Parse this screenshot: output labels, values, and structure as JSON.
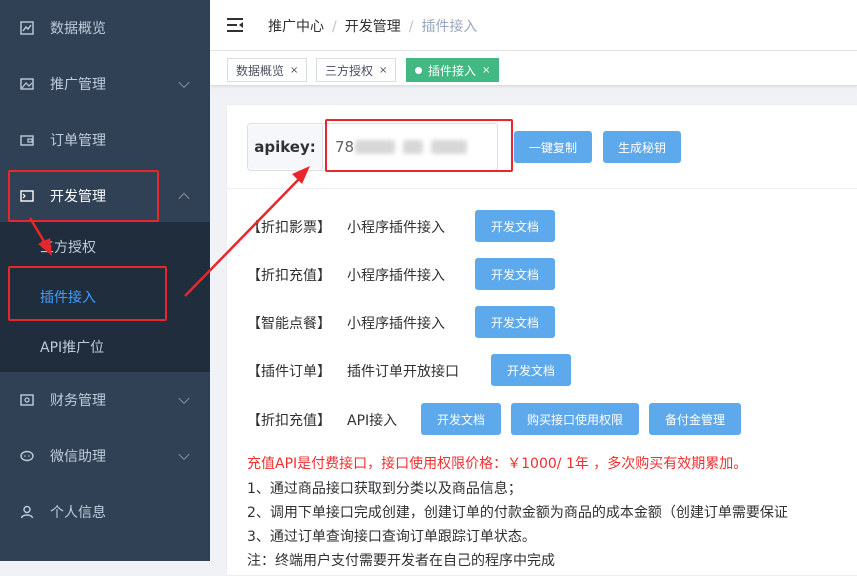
{
  "sidebar": {
    "items": [
      {
        "label": "数据概览",
        "icon": "chart-icon"
      },
      {
        "label": "推广管理",
        "icon": "image-icon"
      },
      {
        "label": "订单管理",
        "icon": "wallet-icon"
      },
      {
        "label": "开发管理",
        "icon": "terminal-icon"
      },
      {
        "label": "财务管理",
        "icon": "safe-icon"
      },
      {
        "label": "微信助理",
        "icon": "chat-icon"
      },
      {
        "label": "个人信息",
        "icon": "user-icon"
      }
    ],
    "submenu": [
      {
        "label": "三方授权"
      },
      {
        "label": "插件接入"
      },
      {
        "label": "API推广位"
      }
    ]
  },
  "breadcrumb": {
    "items": [
      "推广中心",
      "开发管理",
      "插件接入"
    ],
    "separator": "/"
  },
  "tags": [
    {
      "label": "数据概览",
      "close": "×"
    },
    {
      "label": "三方授权",
      "close": "×"
    },
    {
      "label": "插件接入",
      "close": "×"
    }
  ],
  "apikey": {
    "label": "apikey:",
    "value_visible": "78",
    "copy_button": "一键复制",
    "generate_button": "生成秘钥"
  },
  "integrations": [
    {
      "tag": "【折扣影票】",
      "name": "小程序插件接入",
      "buttons": [
        "开发文档"
      ]
    },
    {
      "tag": "【折扣充值】",
      "name": "小程序插件接入",
      "buttons": [
        "开发文档"
      ]
    },
    {
      "tag": "【智能点餐】",
      "name": "小程序插件接入",
      "buttons": [
        "开发文档"
      ]
    },
    {
      "tag": "【插件订单】",
      "name": "插件订单开放接口",
      "buttons": [
        "开发文档"
      ]
    },
    {
      "tag": "【折扣充值】",
      "name": "API接入",
      "buttons": [
        "开发文档",
        "购买接口使用权限",
        "备付金管理"
      ]
    }
  ],
  "notice": {
    "price_text": "充值API是付费接口，接口使用权限价格：￥1000/ 1年 ，多次购买有效期累加。",
    "steps": [
      "1、通过商品接口获取到分类以及商品信息；",
      "2、调用下单接口完成创建，创建订单的付款金额为商品的成本金额（创建订单需要保证",
      "3、通过订单查询接口查询订单跟踪订单状态。",
      "注：终端用户支付需要开发者在自己的程序中完成"
    ]
  },
  "colors": {
    "sidebar_bg": "#304156",
    "submenu_bg": "#1f2d3d",
    "accent": "#409eff",
    "button": "#5ea9ec",
    "active_tag": "#42b983",
    "highlight": "#e8262b",
    "warning_text": "#f03030"
  }
}
